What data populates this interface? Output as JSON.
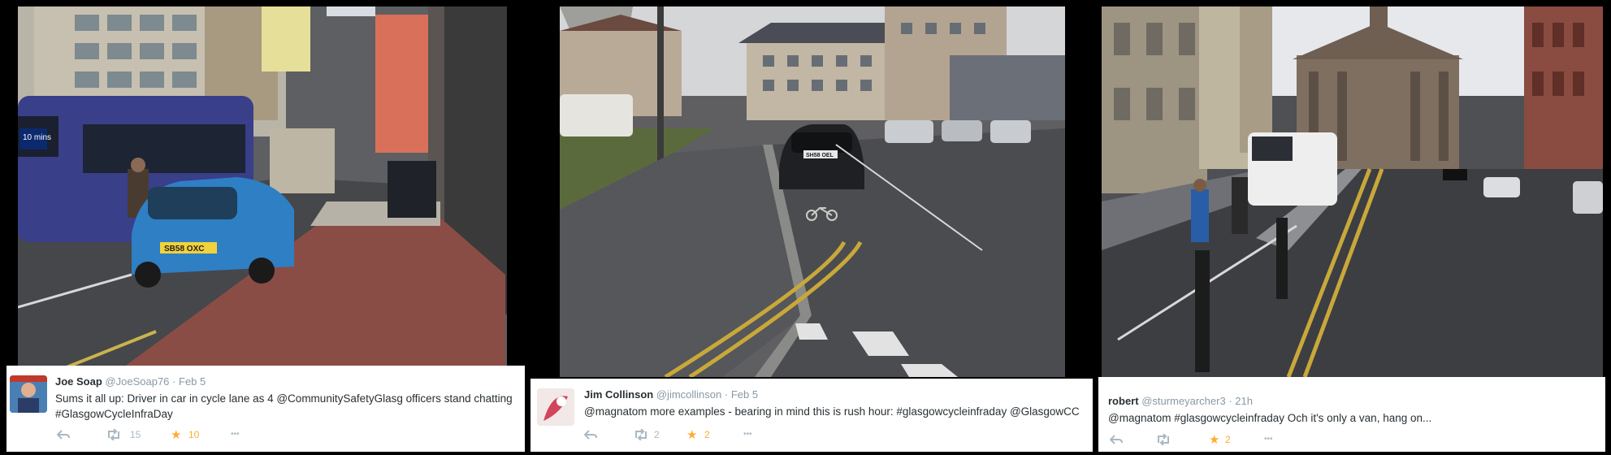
{
  "colors": {
    "star": "#ffac33",
    "meta": "#8899a6",
    "text": "#292f33",
    "icon": "#aab8c2"
  },
  "icons": [
    "reply-icon",
    "retweet-icon",
    "favorite-star-icon",
    "more-dots-icon"
  ],
  "tweets": [
    {
      "name": "Joe Soap",
      "handle": "@JoeSoap76",
      "sep": "·",
      "date": "Feb 5",
      "text_line1": "Sums it all up: Driver in car in cycle lane as 4 @CommunitySafetyGlasg officers stand chatting",
      "text_line2": "#GlasgowCycleInfraDay",
      "retweets": "15",
      "favorites": "10",
      "more": "•••"
    },
    {
      "name": "Jim Collinson",
      "handle": "@jimcollinson",
      "sep": "·",
      "date": "Feb 5",
      "text_line1": "@magnatom more examples - bearing in mind this is rush hour: #glasgowcycleinfraday @GlasgowCC",
      "retweets": "2",
      "favorites": "2",
      "more": "•••"
    },
    {
      "name": "robert",
      "handle": "@sturmeyarcher3",
      "sep": "·",
      "date": "21h",
      "text_line1": "@magnatom #glasgowcycleinfraday Och it's only a van, hang on...",
      "favorites": "2",
      "more": "•••"
    }
  ],
  "scene_text": {
    "plate_left": "SB58 OXC",
    "bus_sign": "10 mins",
    "plate_middle": "SH58 OEL"
  }
}
